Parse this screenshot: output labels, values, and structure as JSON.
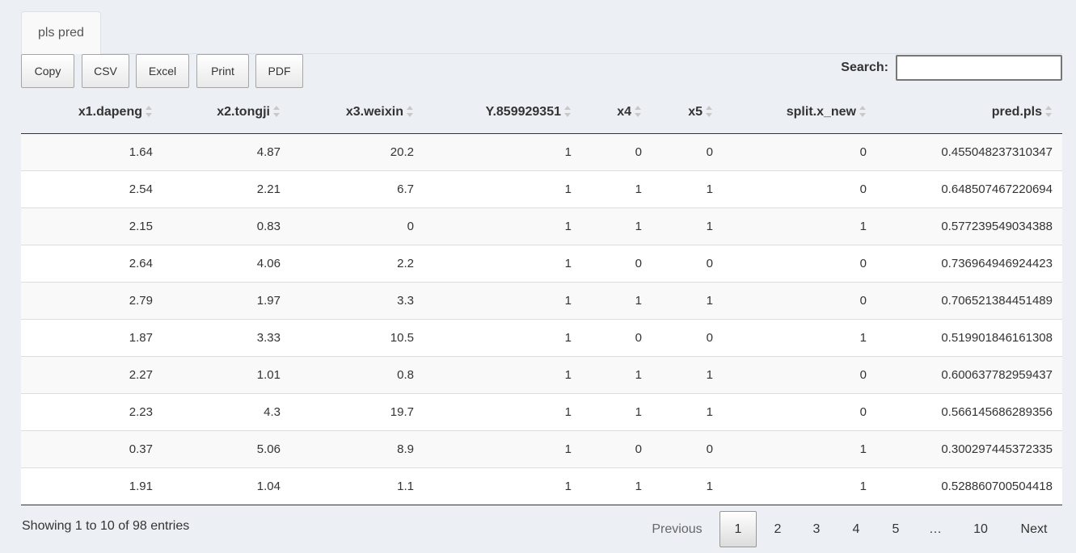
{
  "tabs": [
    {
      "label": "pls pred"
    }
  ],
  "buttons": {
    "copy": "Copy",
    "csv": "CSV",
    "excel": "Excel",
    "print": "Print",
    "pdf": "PDF"
  },
  "search": {
    "label": "Search:",
    "value": ""
  },
  "table": {
    "columns": [
      "x1.dapeng",
      "x2.tongji",
      "x3.weixin",
      "Y.859929351",
      "x4",
      "x5",
      "split.x_new",
      "pred.pls"
    ],
    "rows": [
      [
        "1.64",
        "4.87",
        "20.2",
        "1",
        "0",
        "0",
        "0",
        "0.455048237310347"
      ],
      [
        "2.54",
        "2.21",
        "6.7",
        "1",
        "1",
        "1",
        "0",
        "0.648507467220694"
      ],
      [
        "2.15",
        "0.83",
        "0",
        "1",
        "1",
        "1",
        "1",
        "0.577239549034388"
      ],
      [
        "2.64",
        "4.06",
        "2.2",
        "1",
        "0",
        "0",
        "0",
        "0.736964946924423"
      ],
      [
        "2.79",
        "1.97",
        "3.3",
        "1",
        "1",
        "1",
        "0",
        "0.706521384451489"
      ],
      [
        "1.87",
        "3.33",
        "10.5",
        "1",
        "0",
        "0",
        "1",
        "0.519901846161308"
      ],
      [
        "2.27",
        "1.01",
        "0.8",
        "1",
        "1",
        "1",
        "0",
        "0.600637782959437"
      ],
      [
        "2.23",
        "4.3",
        "19.7",
        "1",
        "1",
        "1",
        "0",
        "0.566145686289356"
      ],
      [
        "0.37",
        "5.06",
        "8.9",
        "1",
        "0",
        "0",
        "1",
        "0.300297445372335"
      ],
      [
        "1.91",
        "1.04",
        "1.1",
        "1",
        "1",
        "1",
        "1",
        "0.528860700504418"
      ]
    ]
  },
  "info": "Showing 1 to 10 of 98 entries",
  "pagination": {
    "previous": "Previous",
    "pages": [
      "1",
      "2",
      "3",
      "4",
      "5",
      "…",
      "10"
    ],
    "current": "1",
    "next": "Next"
  }
}
